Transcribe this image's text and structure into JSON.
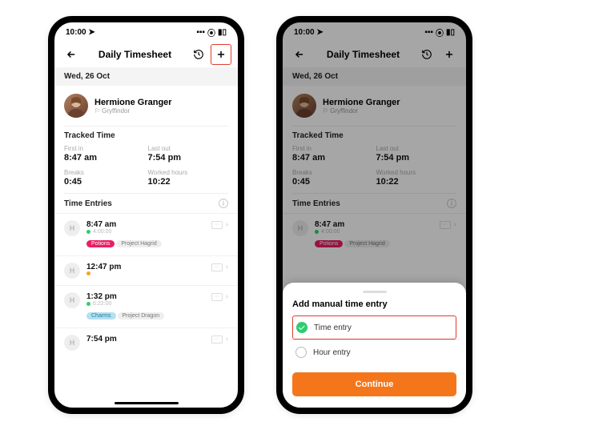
{
  "status": {
    "time": "10:00"
  },
  "header": {
    "title": "Daily Timesheet"
  },
  "date": "Wed, 26 Oct",
  "user": {
    "name": "Hermione Granger",
    "team": "Gryffindor"
  },
  "tracked": {
    "title": "Tracked Time",
    "first_in_label": "First in",
    "first_in": "8:47 am",
    "last_out_label": "Last out",
    "last_out": "7:54 pm",
    "breaks_label": "Breaks",
    "breaks": "0:45",
    "worked_label": "Worked hours",
    "worked": "10:22"
  },
  "entries_title": "Time Entries",
  "entries": [
    {
      "letter": "H",
      "time": "8:47 am",
      "dur": "4:00:00",
      "dot": "green",
      "tags": [
        {
          "text": "Potions",
          "cls": "pink"
        },
        {
          "text": "Project Hagrid",
          "cls": "grey"
        }
      ]
    },
    {
      "letter": "H",
      "time": "12:47 pm",
      "dur": "",
      "dot": "orange",
      "tags": []
    },
    {
      "letter": "H",
      "time": "1:32 pm",
      "dur": "6:22:00",
      "dot": "green",
      "tags": [
        {
          "text": "Charms",
          "cls": "blue"
        },
        {
          "text": "Project Dragon",
          "cls": "grey"
        }
      ]
    },
    {
      "letter": "H",
      "time": "7:54 pm",
      "dur": "",
      "dot": "",
      "tags": []
    }
  ],
  "sheet": {
    "title": "Add manual time entry",
    "opt1": "Time entry",
    "opt2": "Hour entry",
    "continue": "Continue"
  }
}
